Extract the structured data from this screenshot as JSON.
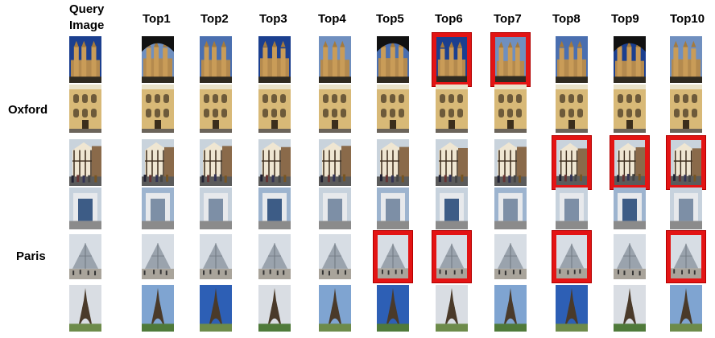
{
  "headers": {
    "query_line1": "Query",
    "query_line2": "Image",
    "ranks": [
      "Top1",
      "Top2",
      "Top3",
      "Top4",
      "Top5",
      "Top6",
      "Top7",
      "Top8",
      "Top9",
      "Top10"
    ]
  },
  "groups": [
    {
      "label": "Oxford",
      "rows": [
        0,
        1,
        2
      ]
    },
    {
      "label": "Paris",
      "rows": [
        3,
        4,
        5
      ]
    }
  ],
  "rows": [
    {
      "scene": "oxford-college-towers",
      "incorrect": [
        6,
        7
      ]
    },
    {
      "scene": "oxford-library-facade",
      "incorrect": []
    },
    {
      "scene": "oxford-street-tudor-houses",
      "incorrect": [
        8,
        9,
        10
      ]
    },
    {
      "scene": "paris-la-defense-arch",
      "incorrect": []
    },
    {
      "scene": "paris-louvre-pyramid",
      "incorrect": [
        5,
        6,
        8,
        10
      ]
    },
    {
      "scene": "paris-eiffel-tower",
      "incorrect": []
    }
  ],
  "colors": {
    "incorrect_border": "#e31414"
  }
}
